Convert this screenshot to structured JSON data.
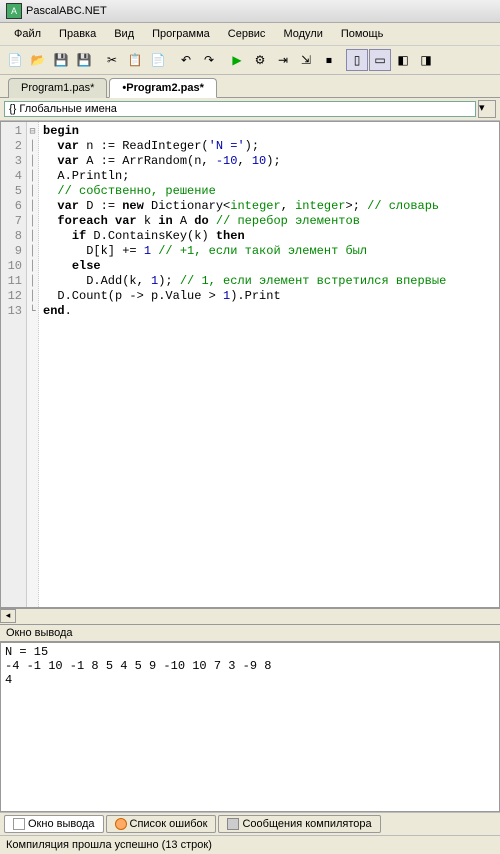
{
  "app": {
    "title": "PascalABC.NET"
  },
  "menu": {
    "file": "Файл",
    "edit": "Правка",
    "view": "Вид",
    "program": "Программа",
    "service": "Сервис",
    "modules": "Модули",
    "help": "Помощь"
  },
  "tabs": {
    "tab1": "Program1.pas*",
    "tab2": "•Program2.pas*"
  },
  "scope": {
    "label": "{} Глобальные имена"
  },
  "code_lines": [
    "1",
    "2",
    "3",
    "4",
    "5",
    "6",
    "7",
    "8",
    "9",
    "10",
    "11",
    "12",
    "13"
  ],
  "code": {
    "l1_kw": "begin",
    "l2a": "  ",
    "l2_kw": "var",
    "l2b": " n := ReadInteger(",
    "l2_str": "'N ='",
    "l2c": ");",
    "l3a": "  ",
    "l3_kw": "var",
    "l3b": " A := ArrRandom(n, ",
    "l3_n1": "-10",
    "l3c": ", ",
    "l3_n2": "10",
    "l3d": ");",
    "l4": "  A.Println;",
    "l5a": "  ",
    "l5_cmt": "// собственно, решение",
    "l6a": "  ",
    "l6_kw": "var",
    "l6b": " D := ",
    "l6_kw2": "new",
    "l6c": " Dictionary<",
    "l6_t1": "integer",
    "l6d": ", ",
    "l6_t2": "integer",
    "l6e": ">; ",
    "l6_cmt": "// словарь",
    "l7a": "  ",
    "l7_kw": "foreach",
    "l7b": " ",
    "l7_kw2": "var",
    "l7c": " k ",
    "l7_kw3": "in",
    "l7d": " A ",
    "l7_kw4": "do",
    "l7e": " ",
    "l7_cmt": "// перебор элементов",
    "l8a": "    ",
    "l8_kw": "if",
    "l8b": " D.ContainsKey(k) ",
    "l8_kw2": "then",
    "l9a": "      D[k] += ",
    "l9_n": "1",
    "l9b": " ",
    "l9_cmt": "// +1, если такой элемент был",
    "l10a": "    ",
    "l10_kw": "else",
    "l11a": "      D.Add(k, ",
    "l11_n": "1",
    "l11b": "); ",
    "l11_cmt": "// 1, если элемент встретился впервые",
    "l12a": "  D.Count(p -> p.Value > ",
    "l12_n": "1",
    "l12b": ").Print",
    "l13_kw": "end",
    "l13b": "."
  },
  "output": {
    "header": "Окно вывода",
    "line1": "N = 15",
    "line2": "-4 -1 10 -1 8 5 4 5 9 -10 10 7 3 -9 8",
    "line3": "4"
  },
  "bottom_tabs": {
    "output": "Окно вывода",
    "errors": "Список ошибок",
    "compiler": "Сообщения компилятора"
  },
  "status": {
    "text": "Компиляция прошла успешно (13 строк)"
  }
}
